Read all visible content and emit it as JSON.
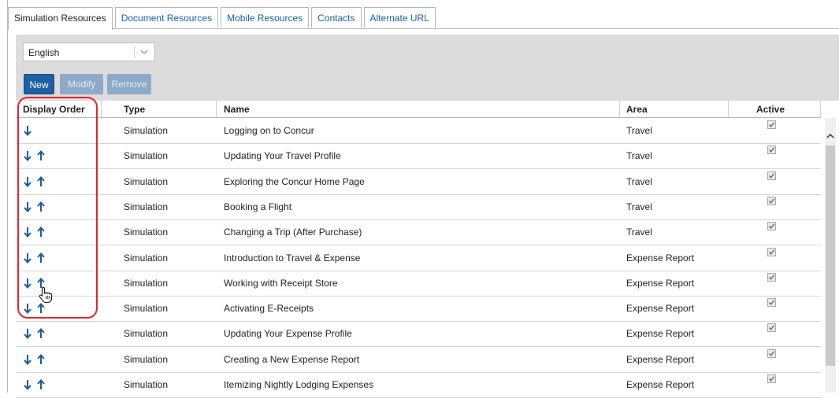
{
  "tabs": [
    {
      "label": "Simulation Resources",
      "active": true
    },
    {
      "label": "Document Resources",
      "active": false
    },
    {
      "label": "Mobile Resources",
      "active": false
    },
    {
      "label": "Contacts",
      "active": false
    },
    {
      "label": "Alternate URL",
      "active": false
    }
  ],
  "toolbar": {
    "language": "English",
    "new_label": "New",
    "modify_label": "Modify",
    "remove_label": "Remove"
  },
  "columns": {
    "display_order": "Display Order",
    "type": "Type",
    "name": "Name",
    "area": "Area",
    "active": "Active"
  },
  "rows": [
    {
      "type": "Simulation",
      "name": "Logging on to Concur",
      "area": "Travel",
      "active": true
    },
    {
      "type": "Simulation",
      "name": "Updating Your Travel Profile",
      "area": "Travel",
      "active": true
    },
    {
      "type": "Simulation",
      "name": "Exploring the Concur Home Page",
      "area": "Travel",
      "active": true
    },
    {
      "type": "Simulation",
      "name": "Booking a Flight",
      "area": "Travel",
      "active": true
    },
    {
      "type": "Simulation",
      "name": "Changing a Trip (After Purchase)",
      "area": "Travel",
      "active": true
    },
    {
      "type": "Simulation",
      "name": "Introduction to Travel & Expense",
      "area": "Expense Report",
      "active": true
    },
    {
      "type": "Simulation",
      "name": "Working with Receipt Store",
      "area": "Expense Report",
      "active": true
    },
    {
      "type": "Simulation",
      "name": "Activating E-Receipts",
      "area": "Expense Report",
      "active": true
    },
    {
      "type": "Simulation",
      "name": "Updating Your Expense Profile",
      "area": "Expense Report",
      "active": true
    },
    {
      "type": "Simulation",
      "name": "Creating a New Expense Report",
      "area": "Expense Report",
      "active": true
    },
    {
      "type": "Simulation",
      "name": "Itemizing Nightly Lodging Expenses",
      "area": "Expense Report",
      "active": true
    }
  ],
  "colors": {
    "accent": "#1f5fa3",
    "arrow": "#1a5aa0",
    "annotation": "#e0262b"
  }
}
